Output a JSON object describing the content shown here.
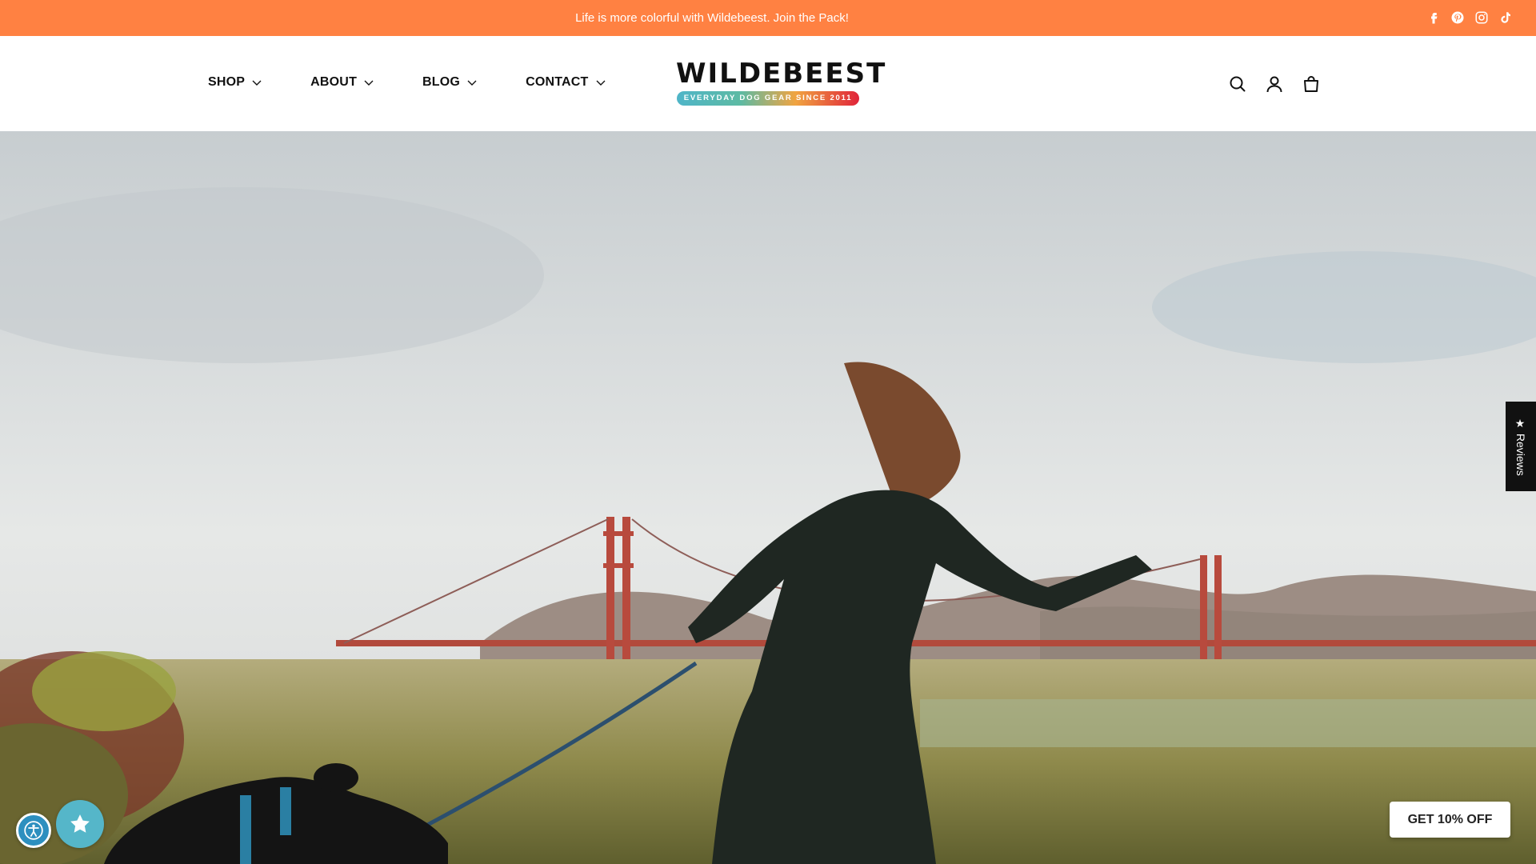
{
  "announcement": {
    "text": "Life is more colorful with Wildebeest. Join the Pack!"
  },
  "social": [
    "facebook-icon",
    "pinterest-icon",
    "instagram-icon",
    "tiktok-icon"
  ],
  "nav": [
    {
      "label": "SHOP"
    },
    {
      "label": "ABOUT"
    },
    {
      "label": "BLOG"
    },
    {
      "label": "CONTACT"
    }
  ],
  "logo": {
    "name": "WILDEBEEST",
    "tagline": "EVERYDAY DOG GEAR SINCE 2011"
  },
  "header_icons": [
    "search-icon",
    "account-icon",
    "cart-icon"
  ],
  "reviews_tab": {
    "label": "★ Reviews"
  },
  "discount_button": {
    "label": "GET 10% OFF"
  },
  "colors": {
    "announcement_bg": "#ff8142",
    "rewards_bg": "#55b6c9",
    "accessibility_bg": "#2d8fbf"
  }
}
